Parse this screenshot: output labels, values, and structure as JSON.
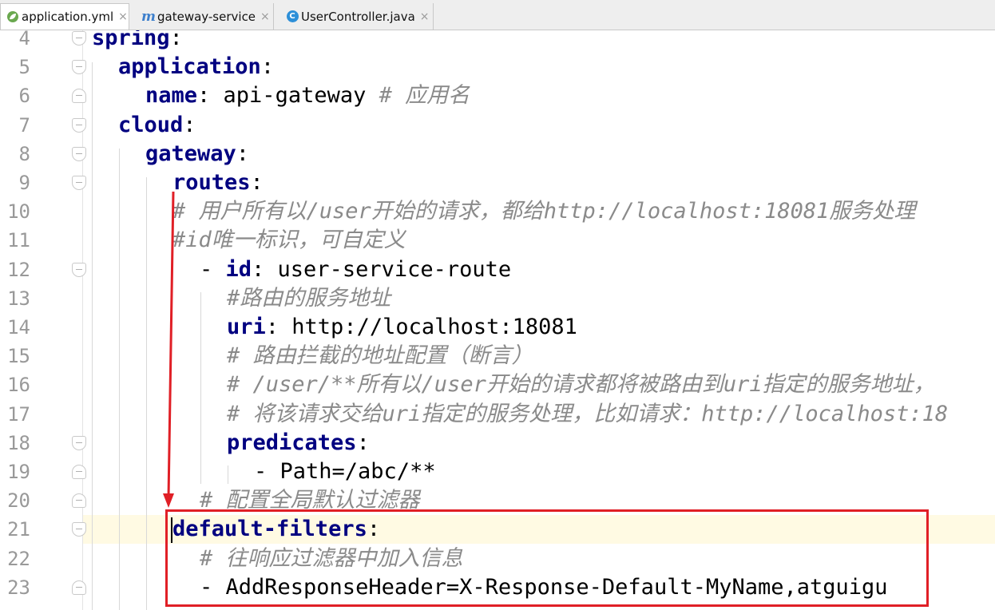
{
  "tabs": [
    {
      "label": "application.yml",
      "icon": "spring-leaf-icon",
      "active": true
    },
    {
      "label": "gateway-service",
      "icon": "maven-m-icon",
      "active": false
    },
    {
      "label": "UserController.java",
      "icon": "java-class-icon",
      "active": false
    }
  ],
  "tab_close": "×",
  "icon_glyphs": {
    "maven": "m",
    "java_class": "C"
  },
  "editor": {
    "current_line": 21,
    "lines": [
      {
        "n": "4",
        "tokens": [
          {
            "t": "spring",
            "c": "key"
          },
          {
            "t": ":",
            "c": "val"
          }
        ]
      },
      {
        "n": "5",
        "tokens": [
          {
            "t": "application",
            "c": "key"
          },
          {
            "t": ":",
            "c": "val"
          }
        ]
      },
      {
        "n": "6",
        "tokens": [
          {
            "t": "name",
            "c": "key"
          },
          {
            "t": ": api-gateway ",
            "c": "val"
          },
          {
            "t": "# 应用名",
            "c": "cmt"
          }
        ]
      },
      {
        "n": "7",
        "tokens": [
          {
            "t": "cloud",
            "c": "key"
          },
          {
            "t": ":",
            "c": "val"
          }
        ]
      },
      {
        "n": "8",
        "tokens": [
          {
            "t": "gateway",
            "c": "key"
          },
          {
            "t": ":",
            "c": "val"
          }
        ]
      },
      {
        "n": "9",
        "tokens": [
          {
            "t": "routes",
            "c": "key"
          },
          {
            "t": ":",
            "c": "val"
          }
        ]
      },
      {
        "n": "10",
        "tokens": [
          {
            "t": "# 用户所有以/user开始的请求，都给http://localhost:18081服务处理",
            "c": "cmt"
          }
        ]
      },
      {
        "n": "11",
        "tokens": [
          {
            "t": "#id唯一标识，可自定义",
            "c": "cmt"
          }
        ]
      },
      {
        "n": "12",
        "tokens": [
          {
            "t": "- ",
            "c": "val"
          },
          {
            "t": "id",
            "c": "key"
          },
          {
            "t": ": user-service-route",
            "c": "val"
          }
        ]
      },
      {
        "n": "13",
        "tokens": [
          {
            "t": "#路由的服务地址",
            "c": "cmt"
          }
        ]
      },
      {
        "n": "14",
        "tokens": [
          {
            "t": "uri",
            "c": "key"
          },
          {
            "t": ": http://localhost:18081",
            "c": "val"
          }
        ]
      },
      {
        "n": "15",
        "tokens": [
          {
            "t": "# 路由拦截的地址配置（断言）",
            "c": "cmt"
          }
        ]
      },
      {
        "n": "16",
        "tokens": [
          {
            "t": "# /user/**所有以/user开始的请求都将被路由到uri指定的服务地址，",
            "c": "cmt"
          }
        ]
      },
      {
        "n": "17",
        "tokens": [
          {
            "t": "# 将该请求交给uri指定的服务处理，比如请求：http://localhost:18",
            "c": "cmt"
          }
        ]
      },
      {
        "n": "18",
        "tokens": [
          {
            "t": "predicates",
            "c": "key"
          },
          {
            "t": ":",
            "c": "val"
          }
        ]
      },
      {
        "n": "19",
        "tokens": [
          {
            "t": "- Path=/abc/**",
            "c": "val"
          }
        ]
      },
      {
        "n": "20",
        "tokens": [
          {
            "t": "# 配置全局默认过滤器",
            "c": "cmt"
          }
        ]
      },
      {
        "n": "21",
        "tokens": [
          {
            "t": "default-filters",
            "c": "key"
          },
          {
            "t": ":",
            "c": "val"
          }
        ]
      },
      {
        "n": "22",
        "tokens": [
          {
            "t": "# 往响应过滤器中加入信息",
            "c": "cmt"
          }
        ]
      },
      {
        "n": "23",
        "tokens": [
          {
            "t": "- AddResponseHeader=X-Response-Default-MyName,atguigu",
            "c": "val"
          }
        ]
      }
    ]
  },
  "annotation_color": "#e01f26"
}
